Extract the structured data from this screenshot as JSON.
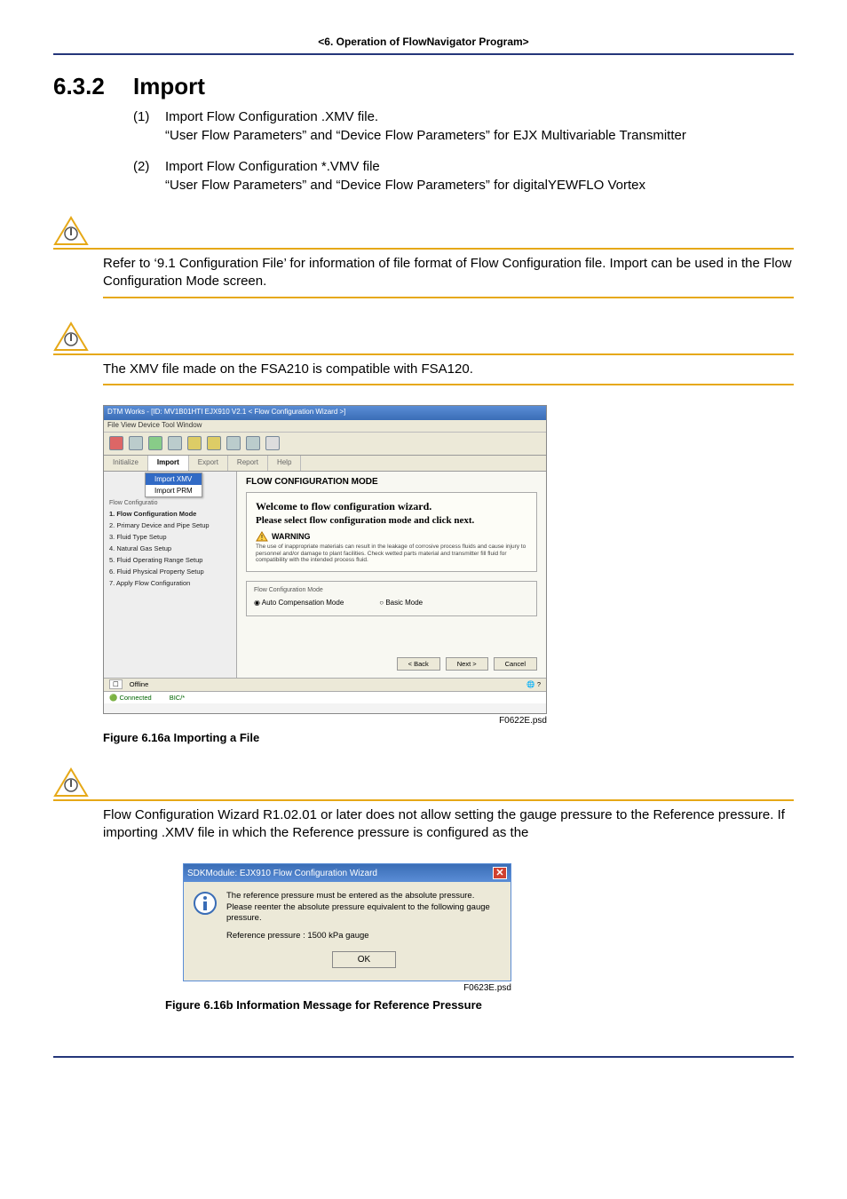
{
  "breadcrumb": "<6.  Operation of FlowNavigator Program>",
  "section": {
    "num": "6.3.2",
    "title": "Import"
  },
  "items": [
    {
      "num": "(1)",
      "title": "Import Flow Configuration .XMV file.",
      "sub": "“User Flow Parameters” and “Device Flow Parameters” for EJX Multivariable Transmitter"
    },
    {
      "num": "(2)",
      "title": "Import Flow Configuration *.VMV file",
      "sub": "“User Flow Parameters” and “Device Flow Parameters” for digitalYEWFLO Vortex"
    }
  ],
  "note1": "Refer to ‘9.1 Configuration File’ for information of file format of Flow Configuration file. Import can be used in the Flow Configuration Mode screen.",
  "note2": "The XMV file made on the FSA210 is compatible with FSA120.",
  "note3": "Flow Configuration Wizard R1.02.01 or later does not allow setting the gauge pressure to the Reference pressure. If importing .XMV file in which the Reference pressure is configured as the",
  "figA": {
    "window_title": "DTM Works - [ID: MV1B01HTI EJX910 V2.1 < Flow Configuration Wizard >]",
    "menus": "File   View   Device   Tool   Window",
    "tabs": {
      "t1": "Initialize",
      "t2": "Import",
      "t3": "Export",
      "t4": "Report",
      "t5": "Help"
    },
    "dropdown": {
      "i1": "Import XMV",
      "i2": "Import PRM"
    },
    "side_group": "Flow Configuratio",
    "side": {
      "s1": "1. Flow Configuration Mode",
      "s2": "2. Primary Device and Pipe Setup",
      "s3": "3. Fluid Type Setup",
      "s4": "4. Natural Gas Setup",
      "s5": "5. Fluid Operating Range Setup",
      "s6": "6. Fluid Physical Property Setup",
      "s7": "7. Apply Flow Configuration"
    },
    "heading": "FLOW CONFIGURATION MODE",
    "welcome": "Welcome to flow configuration  wizard.",
    "please": "Please select flow configuration mode and click next.",
    "warn_label": "WARNING",
    "warn_text": "The use of inappropriate materials can result in the leakage of corrosive process fluids and cause injury to personnel and/or damage to plant facilities. Check wetted parts material and transmitter fill fluid for compatibility with the intended process fluid.",
    "mode_title": "Flow Configuration Mode",
    "radio1": "Auto Compensation Mode",
    "radio2": "Basic Mode",
    "btn_back": "< Back",
    "btn_next": "Next >",
    "btn_cancel": "Cancel",
    "status1": "Offline",
    "status2a": "Connected",
    "status2b": "BIC/*",
    "psd": "F0622E.psd",
    "caption": "Figure 6.16a    Importing a File"
  },
  "figB": {
    "title": "SDKModule: EJX910 Flow Configuration Wizard",
    "line1": "The reference pressure must be entered as the absolute pressure.",
    "line2": "Please reenter the absolute pressure equivalent to the following gauge pressure.",
    "ref": "Reference pressure :  1500 kPa gauge",
    "ok": "OK",
    "psd": "F0623E.psd",
    "caption": "Figure 6.16b  Information Message for Reference Pressure"
  }
}
